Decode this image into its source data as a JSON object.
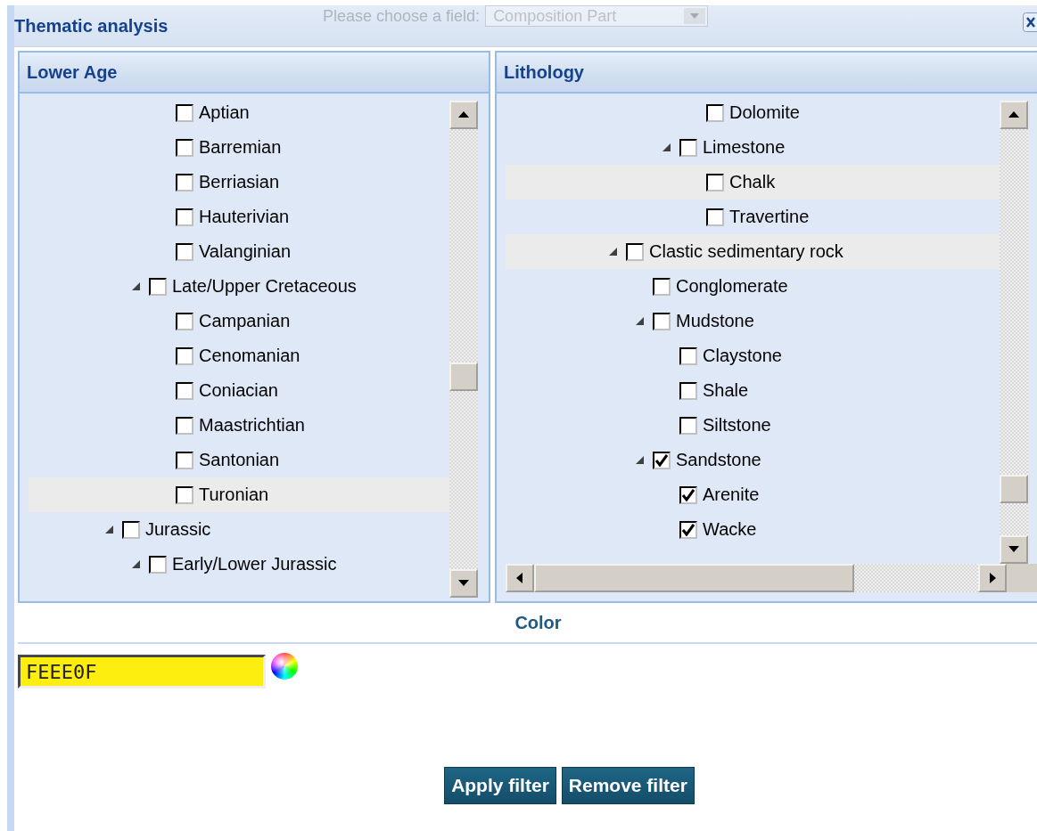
{
  "window": {
    "title": "Thematic analysis"
  },
  "background_field": {
    "label": "Please choose a field:",
    "value": "Composition Part"
  },
  "panels": [
    {
      "title": "Lower Age",
      "tree": [
        {
          "children": [
            {
              "children": [
                {
                  "label": "Aptian",
                  "checked": false,
                  "highlighted": false
                },
                {
                  "label": "Barremian",
                  "checked": false,
                  "highlighted": false
                },
                {
                  "label": "Berriasian",
                  "checked": false,
                  "highlighted": false
                },
                {
                  "label": "Hauterivian",
                  "checked": false,
                  "highlighted": false
                },
                {
                  "label": "Valanginian",
                  "checked": false,
                  "highlighted": false
                }
              ]
            },
            {
              "label": "Late/Upper Cretaceous",
              "checked": false,
              "highlighted": false,
              "expanded": true,
              "children": [
                {
                  "label": "Campanian",
                  "checked": false,
                  "highlighted": false
                },
                {
                  "label": "Cenomanian",
                  "checked": false,
                  "highlighted": false
                },
                {
                  "label": "Coniacian",
                  "checked": false,
                  "highlighted": false
                },
                {
                  "label": "Maastrichtian",
                  "checked": false,
                  "highlighted": false
                },
                {
                  "label": "Santonian",
                  "checked": false,
                  "highlighted": false
                },
                {
                  "label": "Turonian",
                  "checked": false,
                  "highlighted": true
                }
              ]
            }
          ]
        },
        {
          "label": "Jurassic",
          "checked": false,
          "highlighted": false,
          "expanded": true,
          "children": [
            {
              "label": "Early/Lower Jurassic",
              "checked": false,
              "highlighted": false,
              "expanded": true
            }
          ]
        }
      ]
    },
    {
      "title": "Lithology",
      "tree": [
        {
          "children": [
            {
              "children": [
                {
                  "children": [
                    {
                      "children": [
                        {
                          "label": "Dolomite",
                          "checked": false,
                          "highlighted": false
                        }
                      ]
                    },
                    {
                      "label": "Limestone",
                      "checked": false,
                      "highlighted": false,
                      "expanded": true,
                      "children": [
                        {
                          "label": "Chalk",
                          "checked": false,
                          "highlighted": true
                        },
                        {
                          "label": "Travertine",
                          "checked": false,
                          "highlighted": false
                        }
                      ]
                    }
                  ]
                }
              ]
            },
            {
              "label": "Clastic sedimentary rock",
              "checked": false,
              "highlighted": true,
              "expanded": true,
              "children": [
                {
                  "label": "Conglomerate",
                  "checked": false,
                  "highlighted": false
                },
                {
                  "label": "Mudstone",
                  "checked": false,
                  "highlighted": false,
                  "expanded": true,
                  "children": [
                    {
                      "label": "Claystone",
                      "checked": false,
                      "highlighted": false
                    },
                    {
                      "label": "Shale",
                      "checked": false,
                      "highlighted": false
                    },
                    {
                      "label": "Siltstone",
                      "checked": false,
                      "highlighted": false
                    }
                  ]
                },
                {
                  "label": "Sandstone",
                  "checked": true,
                  "highlighted": false,
                  "expanded": true,
                  "children": [
                    {
                      "label": "Arenite",
                      "checked": true,
                      "highlighted": false
                    },
                    {
                      "label": "Wacke",
                      "checked": true,
                      "highlighted": false
                    }
                  ]
                }
              ]
            }
          ]
        }
      ]
    }
  ],
  "color_section": {
    "title": "Color",
    "value": "FEEE0F"
  },
  "buttons": [
    "Apply filter",
    "Remove filter"
  ]
}
